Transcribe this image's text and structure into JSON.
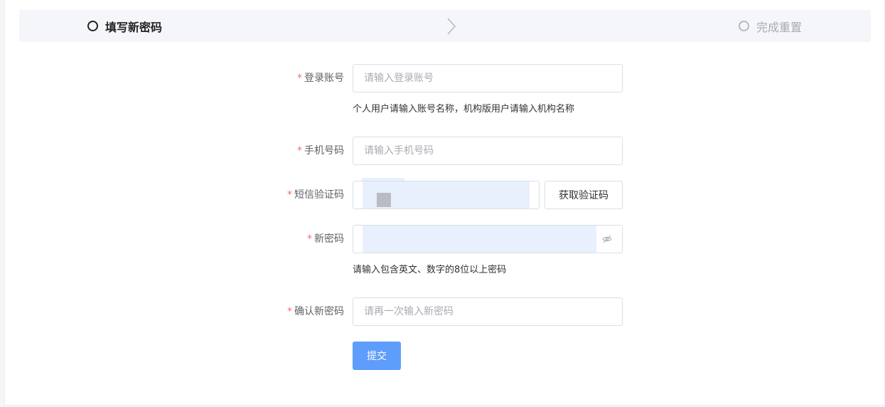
{
  "steps": {
    "step1_label": "填写新密码",
    "step2_label": "完成重置"
  },
  "form": {
    "account": {
      "label": "登录账号",
      "placeholder": "请输入登录账号",
      "hint": "个人用户请输入账号名称，机构版用户请输入机构名称"
    },
    "phone": {
      "label": "手机号码",
      "placeholder": "请输入手机号码"
    },
    "sms_code": {
      "label": "短信验证码",
      "button": "获取验证码"
    },
    "new_password": {
      "label": "新密码",
      "hint": "请输入包含英文、数字的8位以上密码"
    },
    "confirm_password": {
      "label": "确认新密码",
      "placeholder": "请再一次输入新密码"
    },
    "required_mark": "*",
    "submit_label": "提交"
  },
  "colors": {
    "primary_button": "#5e9dfb",
    "required_star": "#f56c6c",
    "autofill_bg": "#e8f0fe",
    "steps_bg": "#f5f6fa"
  },
  "icons": {
    "step_active": "circle-outline-icon",
    "step_pending": "circle-outline-icon",
    "separator": "chevron-right-icon",
    "password_toggle": "eye-off-icon"
  }
}
